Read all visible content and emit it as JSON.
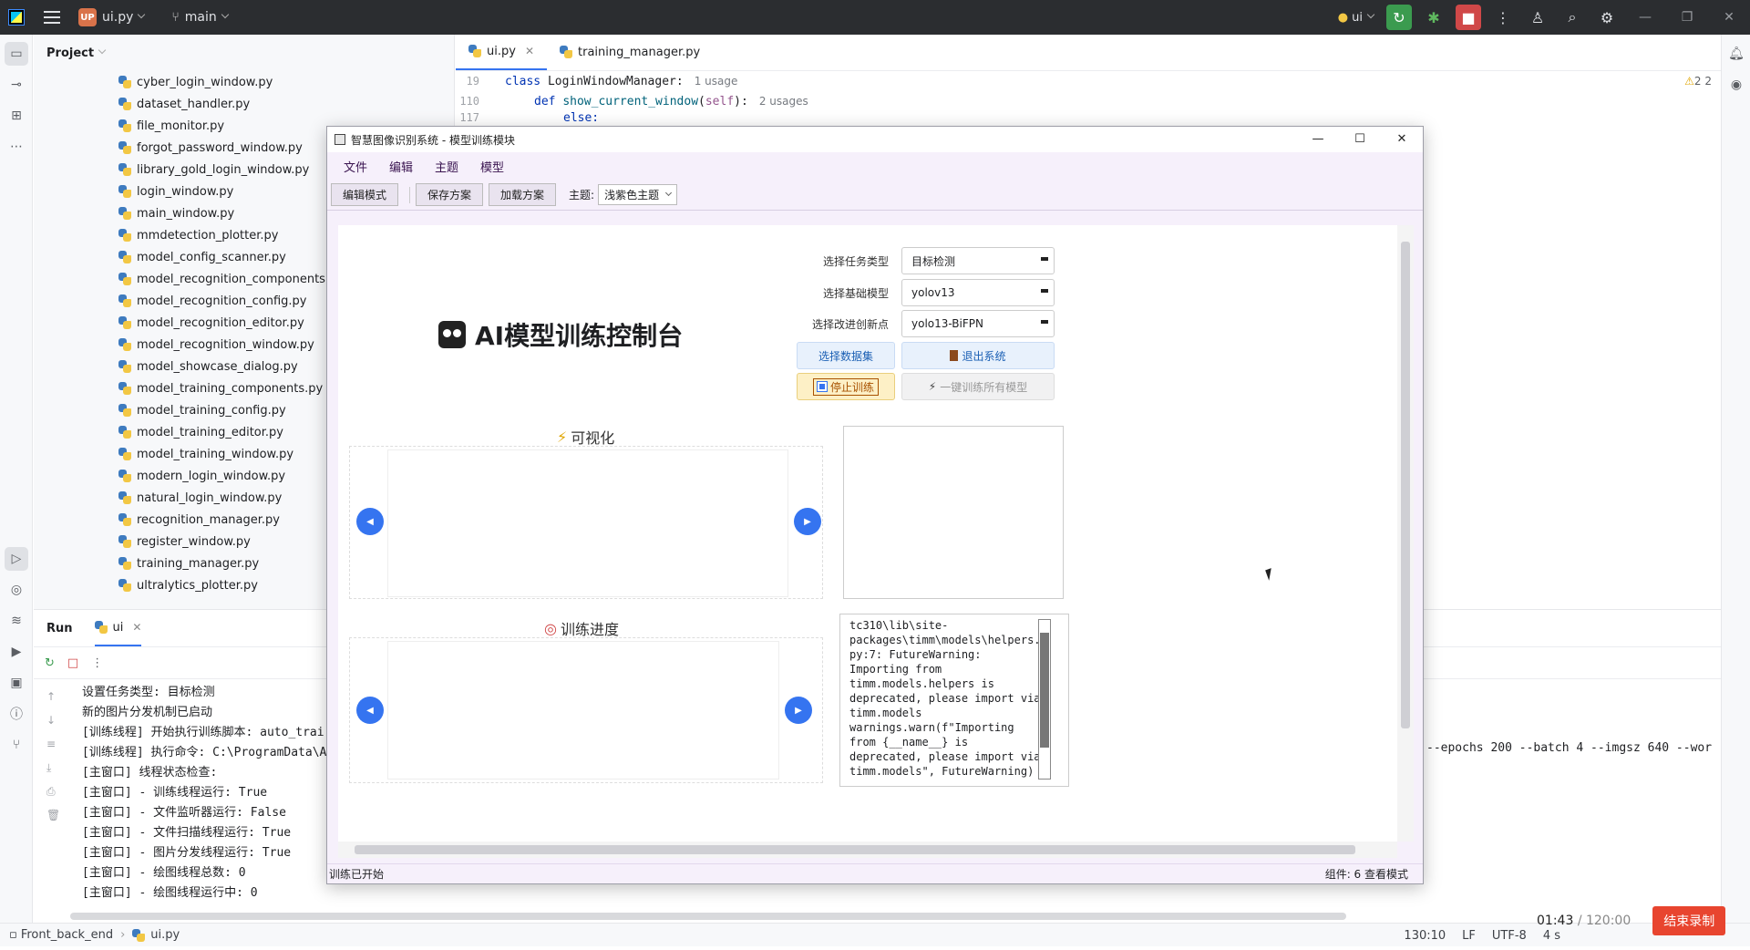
{
  "titlebar": {
    "project_badge": "UP",
    "project_name": "ui.py",
    "branch": "main",
    "run_config": "ui"
  },
  "project_panel": {
    "title": "Project",
    "files": [
      "cyber_login_window.py",
      "dataset_handler.py",
      "file_monitor.py",
      "forgot_password_window.py",
      "library_gold_login_window.py",
      "login_window.py",
      "main_window.py",
      "mmdetection_plotter.py",
      "model_config_scanner.py",
      "model_recognition_components.py",
      "model_recognition_config.py",
      "model_recognition_editor.py",
      "model_recognition_window.py",
      "model_showcase_dialog.py",
      "model_training_components.py",
      "model_training_config.py",
      "model_training_editor.py",
      "model_training_window.py",
      "modern_login_window.py",
      "natural_login_window.py",
      "recognition_manager.py",
      "register_window.py",
      "training_manager.py",
      "ultralytics_plotter.py"
    ]
  },
  "editor": {
    "tabs": [
      {
        "label": "ui.py",
        "active": true
      },
      {
        "label": "training_manager.py",
        "active": false
      }
    ],
    "lines": [
      {
        "num": "19",
        "code_kw": "class",
        "code_name": "LoginWindowManager:",
        "usage": "1 usage"
      },
      {
        "num": "110",
        "code_kw": "def",
        "code_name": "show_current_window",
        "code_arg": "self",
        "usage": "2 usages"
      },
      {
        "num": "117",
        "code": "else:"
      }
    ],
    "warnings": "2  2"
  },
  "run_panel": {
    "title": "Run",
    "tab": "ui",
    "console": [
      "设置任务类型: 目标检测",
      "新的图片分发机制已启动",
      "[训练线程] 开始执行训练脚本: auto_trai",
      "[训练线程] 执行命令: C:\\ProgramData\\A",
      "[主窗口] 线程状态检查:",
      "[主窗口] - 训练线程运行: True",
      "[主窗口] - 文件监听器运行: False",
      "[主窗口] - 文件扫描线程运行: True",
      "[主窗口] - 图片分发线程运行: True",
      "[主窗口] - 绘图线程总数: 0",
      "[主窗口] - 绘图线程运行中: 0"
    ],
    "console_overflow": "--epochs 200 --batch 4 --imgsz 640 --wor"
  },
  "statusbar": {
    "breadcrumb_root": "Front_back_end",
    "breadcrumb_file": "ui.py",
    "position": "130:10",
    "line_sep": "LF",
    "encoding": "UTF-8",
    "indent": "4 s"
  },
  "recording": {
    "elapsed": "01:43",
    "total": "/ 120:00",
    "stop_label": "结束录制"
  },
  "dialog": {
    "title": "智慧图像识别系统 - 模型训练模块",
    "menu": [
      "文件",
      "编辑",
      "主题",
      "模型"
    ],
    "toolbar": {
      "edit_mode": "编辑模式",
      "save_plan": "保存方案",
      "load_plan": "加载方案",
      "theme_label": "主题:",
      "theme_value": "浅紫色主题"
    },
    "heading": "AI模型训练控制台",
    "form": {
      "task_label": "选择任务类型",
      "task_value": "目标检测",
      "model_label": "选择基础模型",
      "model_value": "yolov13",
      "improve_label": "选择改进创新点",
      "improve_value": "yolo13-BiFPN"
    },
    "buttons": {
      "select_dataset": "选择数据集",
      "exit_system": "退出系统",
      "stop_training": "停止训练",
      "train_all": "一键训练所有模型"
    },
    "sections": {
      "visualize": "可视化",
      "progress": "训练进度"
    },
    "log_text": "tc310\\lib\\site-\npackages\\timm\\models\\helpers.\npy:7: FutureWarning:\nImporting from\ntimm.models.helpers is\ndeprecated, please import via\ntimm.models\nwarnings.warn(f\"Importing\nfrom {__name__} is\ndeprecated, please import via\ntimm.models\", FutureWarning)",
    "status_left": "训练已开始",
    "status_right": "组件: 6  查看模式"
  }
}
